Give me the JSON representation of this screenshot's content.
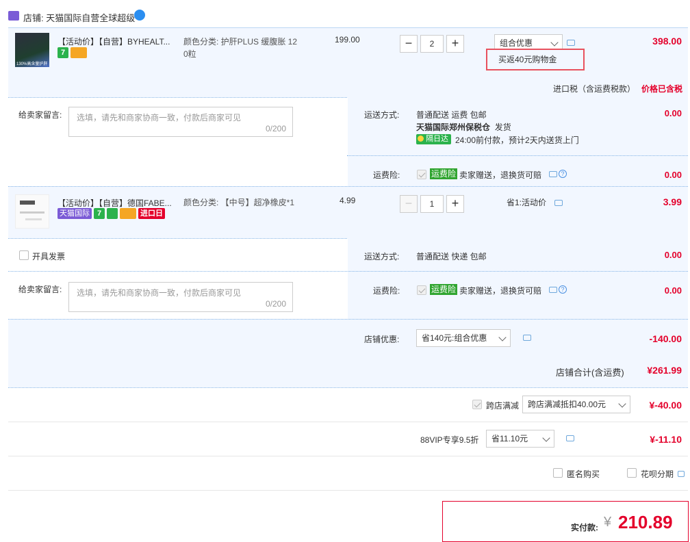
{
  "store": {
    "label": "店铺:",
    "name": "天猫国际自营全球超级"
  },
  "item1": {
    "title": "【活动价】【自营】BYHEALT...",
    "sku": "颜色分类: 护肝PLUS 缓腹胀 120粒",
    "sku_line1": "颜色分类: 护肝PLUS 缓腹胀 12",
    "sku_line2": "0粒",
    "price": "199.00",
    "qty": "2",
    "promo_select": "组合优惠",
    "promo_note": "买返40元购物金",
    "total": "398.00",
    "tax_label": "进口税（含运费税款）",
    "tax_value": "价格已含税",
    "thumb_text": "130%高含量护肝草"
  },
  "message1": {
    "label": "给卖家留言:",
    "placeholder": "选填，请先和商家协商一致，付款后商家可见",
    "count": "0/200"
  },
  "shipping1": {
    "label": "运送方式:",
    "method": "普通配送 运费 包邮",
    "warehouse": "天猫国际郑州保税仓",
    "ship_text": "发货",
    "badge": "隔日达",
    "eta": "24:00前付款，预计2天内送货上门",
    "fee": "0.00"
  },
  "insurance1": {
    "label": "运费险:",
    "badge": "运费险",
    "text": "卖家赠送，退换货可赔",
    "fee": "0.00"
  },
  "item2": {
    "title": "【活动价】【自营】德国FABE...",
    "sku": "颜色分类: 【中号】超净橡皮*1",
    "price": "4.99",
    "qty": "1",
    "promo_text": "省1:活动价",
    "total": "3.99",
    "badge_tmall": "天猫国际",
    "badge_import": "进口日"
  },
  "invoice": {
    "label": "开具发票"
  },
  "shipping2": {
    "label": "运送方式:",
    "method": "普通配送 快递 包邮",
    "fee": "0.00"
  },
  "message2": {
    "label": "给卖家留言:",
    "placeholder": "选填，请先和商家协商一致，付款后商家可见",
    "count": "0/200"
  },
  "insurance2": {
    "label": "运费险:",
    "badge": "运费险",
    "text": "卖家赠送，退换货可赔",
    "fee": "0.00"
  },
  "store_discount": {
    "label": "店铺优惠:",
    "select": "省140元:组合优惠",
    "value": "-140.00"
  },
  "store_total": {
    "label": "店铺合计(含运费)",
    "value": "¥261.99"
  },
  "cross_store": {
    "label": "跨店满减",
    "select": "跨店满减抵扣40.00元",
    "value": "¥-40.00"
  },
  "vip": {
    "label": "88VIP专享9.5折",
    "select": "省11.10元",
    "value": "¥-11.10"
  },
  "options": {
    "anonymous": "匿名购买",
    "installment": "花呗分期"
  },
  "payment": {
    "label": "实付款:",
    "currency": "¥",
    "amount": "210.89"
  },
  "colors": {
    "accent_red": "#e4002b",
    "highlight_border": "#e8515e",
    "row_bg": "#f2f7ff"
  }
}
